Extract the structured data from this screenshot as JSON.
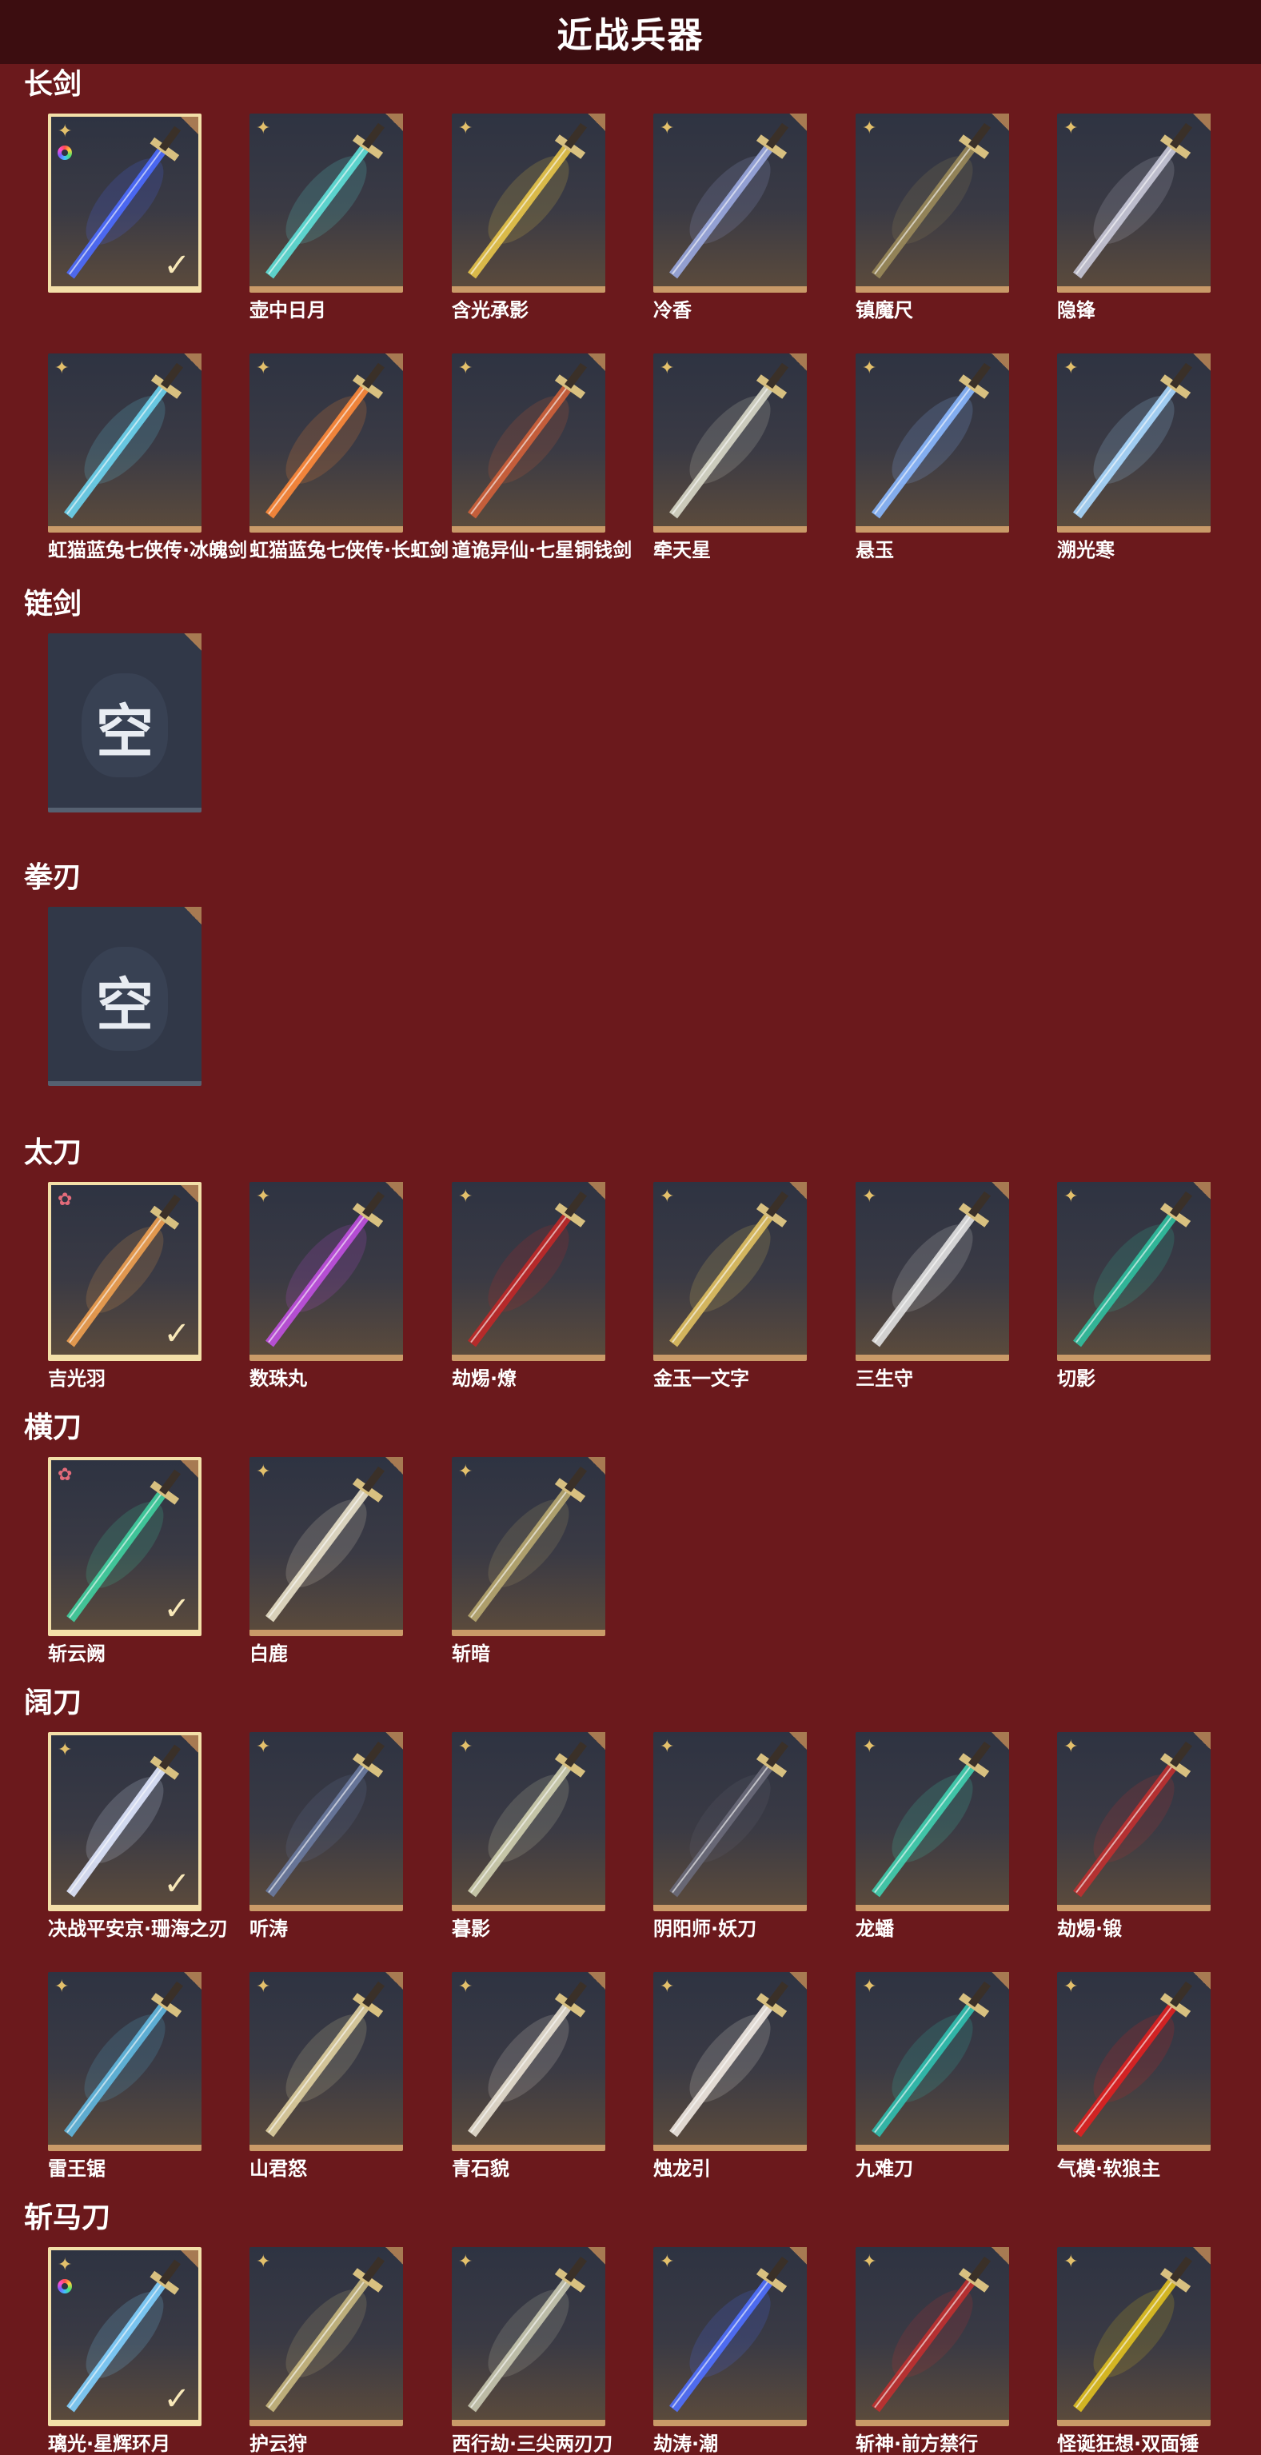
{
  "header": {
    "title": "近战兵器"
  },
  "categories": [
    {
      "title": "长剑",
      "items": [
        {
          "name": "",
          "rarity": "gold",
          "selected": true,
          "rainbow": true,
          "color": "#4d6bff"
        },
        {
          "name": "壶中日月",
          "rarity": "gold",
          "color": "#5ee0d8"
        },
        {
          "name": "含光承影",
          "rarity": "gold",
          "color": "#e8c54a"
        },
        {
          "name": "冷香",
          "rarity": "gold",
          "color": "#9aa8e0"
        },
        {
          "name": "镇魔尺",
          "rarity": "gold",
          "color": "#9a8a5a"
        },
        {
          "name": "隐锋",
          "rarity": "gold",
          "color": "#c8c8d8"
        },
        {
          "name": "虹猫蓝兔七侠传·冰魄剑",
          "rarity": "gold",
          "color": "#6cd4f0"
        },
        {
          "name": "虹猫蓝兔七侠传·长虹剑",
          "rarity": "gold",
          "color": "#ff8a3a"
        },
        {
          "name": "道诡异仙·七星铜钱剑",
          "rarity": "gold",
          "color": "#d0603a"
        },
        {
          "name": "牵天星",
          "rarity": "gold",
          "color": "#d8d8c8"
        },
        {
          "name": "悬玉",
          "rarity": "gold",
          "color": "#8ab8ff"
        },
        {
          "name": "溯光寒",
          "rarity": "gold",
          "color": "#a8d8ff"
        }
      ]
    },
    {
      "title": "链剑",
      "empty": true,
      "empty_label": "空"
    },
    {
      "title": "拳刃",
      "empty": true,
      "empty_label": "空"
    },
    {
      "title": "太刀",
      "items": [
        {
          "name": "吉光羽",
          "rarity": "pink",
          "selected": true,
          "color": "#f0a050"
        },
        {
          "name": "数珠丸",
          "rarity": "gold",
          "color": "#c050e0"
        },
        {
          "name": "劫焬·燎",
          "rarity": "gold",
          "color": "#c02828"
        },
        {
          "name": "金玉一文字",
          "rarity": "gold",
          "color": "#e0c060"
        },
        {
          "name": "三生守",
          "rarity": "gold",
          "color": "#e0e0e0"
        },
        {
          "name": "切影",
          "rarity": "gold",
          "color": "#30c0a0"
        }
      ]
    },
    {
      "title": "横刀",
      "items": [
        {
          "name": "斩云阙",
          "rarity": "pink",
          "selected": true,
          "color": "#40d0a0"
        },
        {
          "name": "白鹿",
          "rarity": "gold",
          "color": "#e8e0c8"
        },
        {
          "name": "斩暗",
          "rarity": "gold",
          "color": "#b8a870"
        }
      ]
    },
    {
      "title": "阔刀",
      "items": [
        {
          "name": "决战平安京·珊海之刃",
          "rarity": "gold",
          "selected": true,
          "color": "#e0e8ff"
        },
        {
          "name": "听涛",
          "rarity": "gold",
          "color": "#6a7aa0"
        },
        {
          "name": "暮影",
          "rarity": "gold",
          "color": "#d0d0b0"
        },
        {
          "name": "阴阳师·妖刀",
          "rarity": "gold",
          "color": "#6a6a7a"
        },
        {
          "name": "龙蟠",
          "rarity": "gold",
          "color": "#40d0b0"
        },
        {
          "name": "劫焬·锻",
          "rarity": "gold",
          "color": "#c03030"
        },
        {
          "name": "雷王锯",
          "rarity": "gold",
          "color": "#60b8e0"
        },
        {
          "name": "山君怒",
          "rarity": "gold",
          "color": "#e0d0a0"
        },
        {
          "name": "青石貌",
          "rarity": "gold",
          "color": "#e8e0d0"
        },
        {
          "name": "烛龙引",
          "rarity": "gold",
          "color": "#f0e8e0"
        },
        {
          "name": "九难刀",
          "rarity": "gold",
          "color": "#30c0b0"
        },
        {
          "name": "气模·软狼主",
          "rarity": "gold",
          "color": "#e02020"
        }
      ]
    },
    {
      "title": "斩马刀",
      "items": [
        {
          "name": "璃光·星辉环月",
          "rarity": "gold",
          "selected": true,
          "rainbow": true,
          "color": "#80d0ff"
        },
        {
          "name": "护云狩",
          "rarity": "gold",
          "color": "#c8b880"
        },
        {
          "name": "西行劫·三尖两刃刀",
          "rarity": "gold",
          "color": "#c8c8b0"
        },
        {
          "name": "劫涛·潮",
          "rarity": "gold",
          "color": "#5070ff"
        },
        {
          "name": "斩神·前方禁行",
          "rarity": "gold",
          "color": "#c03030"
        },
        {
          "name": "怪诞狂想·双面锤",
          "rarity": "gold",
          "color": "#e0c020"
        }
      ]
    }
  ]
}
